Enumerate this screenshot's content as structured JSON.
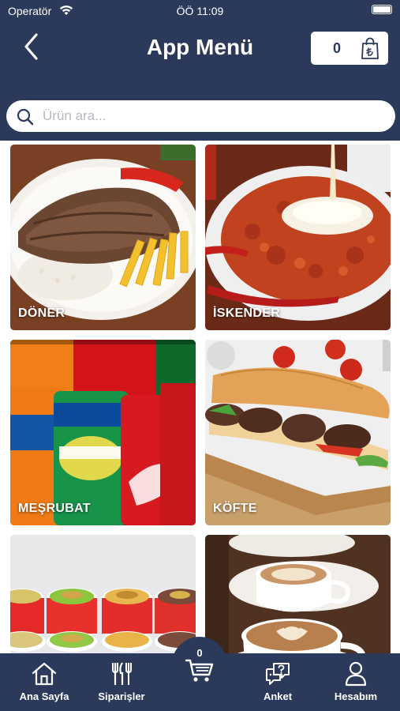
{
  "status_bar": {
    "carrier": "Operatör",
    "time": "ÖÖ 11:09"
  },
  "header": {
    "title": "App Menü",
    "cart_count": "0"
  },
  "search": {
    "placeholder": "Ürün ara..."
  },
  "categories": [
    {
      "label": "DÖNER"
    },
    {
      "label": "İSKENDER"
    },
    {
      "label": "MEŞRUBAT"
    },
    {
      "label": "KÖFTE"
    },
    {
      "label": ""
    },
    {
      "label": ""
    }
  ],
  "tabbar": {
    "home": "Ana Sayfa",
    "orders": "Siparişler",
    "cart_count": "0",
    "survey": "Anket",
    "account": "Hesabım"
  },
  "colors": {
    "primary": "#2b3a5b",
    "background": "#ffffff"
  }
}
